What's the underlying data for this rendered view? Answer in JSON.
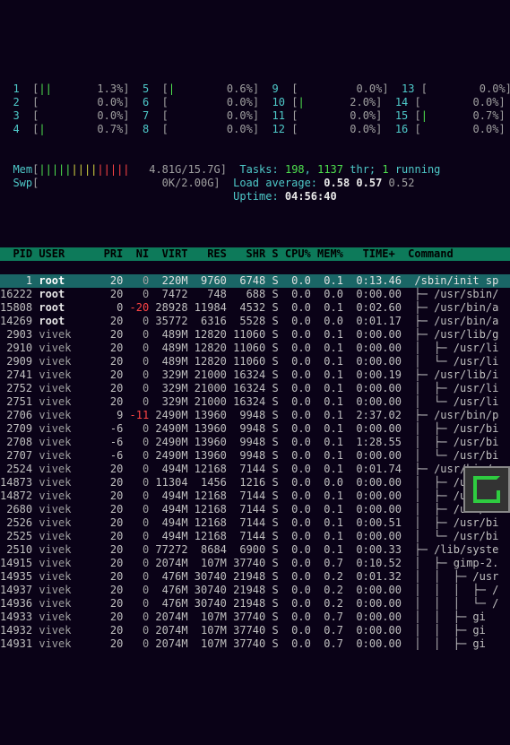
{
  "cpu_meters_left": [
    {
      "id": "1",
      "bar": "[||      ",
      "pct": "1.3%]"
    },
    {
      "id": "2",
      "bar": "[        ",
      "pct": "0.0%]"
    },
    {
      "id": "3",
      "bar": "[        ",
      "pct": "0.0%]"
    },
    {
      "id": "4",
      "bar": "[|       ",
      "pct": "0.7%]"
    }
  ],
  "cpu_meters_r2": [
    {
      "id": "5",
      "bar": "[|       ",
      "pct": "0.6%]"
    },
    {
      "id": "6",
      "bar": "[        ",
      "pct": "0.0%]"
    },
    {
      "id": "7",
      "bar": "[        ",
      "pct": "0.0%]"
    },
    {
      "id": "8",
      "bar": "[        ",
      "pct": "0.0%]"
    }
  ],
  "cpu_meters_r3": [
    {
      "id": "9",
      "bar": "[        ",
      "pct": "0.0%]"
    },
    {
      "id": "10",
      "bar": "[|      ",
      "pct": "2.0%]"
    },
    {
      "id": "11",
      "bar": "[       ",
      "pct": "0.0%]"
    },
    {
      "id": "12",
      "bar": "[       ",
      "pct": "0.0%]"
    }
  ],
  "cpu_meters_r4": [
    {
      "id": "13",
      "bar": "[       ",
      "pct": "0.0%]"
    },
    {
      "id": "14",
      "bar": "[       ",
      "pct": "0.0%]"
    },
    {
      "id": "15",
      "bar": "[|      ",
      "pct": "0.7%]"
    },
    {
      "id": "16",
      "bar": "[       ",
      "pct": "0.0%]"
    }
  ],
  "mem": {
    "label": "Mem",
    "bar": "[|||||||||||||||||  ",
    "val": "4.81G/15.7G]"
  },
  "swp": {
    "label": "Swp",
    "bar": "[                   ",
    "val": "0K/2.00G]"
  },
  "tasks": {
    "label": "Tasks:",
    "procs": "198",
    "sep": ", ",
    "threads": "1137",
    "thr": " thr; ",
    "run": "1",
    "running": " running"
  },
  "loadavg": {
    "label": "Load average:",
    "v1": "0.58",
    "v2": "0.57",
    "v3": "0.52"
  },
  "uptime": {
    "label": "Uptime:",
    "val": "04:56:40"
  },
  "header": "  PID USER      PRI  NI  VIRT   RES   SHR S CPU% MEM%   TIME+  Command",
  "rows": [
    {
      "hl": true,
      "pid": "1",
      "user": "root",
      "pri": "20",
      "ni": "0",
      "virt": "220M",
      "res": "9760",
      "shr": "6748",
      "s": "S",
      "cpu": "0.0",
      "mem": "0.1",
      "time": "0:13.46",
      "cmd": "/sbin/init sp"
    },
    {
      "pid": "16222",
      "user": "root",
      "pri": "20",
      "ni": "0",
      "virt": "7472",
      "res": "748",
      "shr": "688",
      "s": "S",
      "cpu": "0.0",
      "mem": "0.0",
      "time": "0:00.00",
      "cmd": "├─ /usr/sbin/"
    },
    {
      "pid": "15808",
      "user": "root",
      "pri": "0",
      "ni": "-20",
      "virt": "28928",
      "res": "11984",
      "shr": "4532",
      "s": "S",
      "cpu": "0.0",
      "mem": "0.1",
      "time": "0:02.60",
      "cmd": "├─ /usr/bin/a"
    },
    {
      "pid": "14269",
      "user": "root",
      "pri": "20",
      "ni": "0",
      "virt": "35772",
      "res": "6316",
      "shr": "5528",
      "s": "S",
      "cpu": "0.0",
      "mem": "0.0",
      "time": "0:01.17",
      "cmd": "├─ /usr/bin/a"
    },
    {
      "pid": "2903",
      "user": "vivek",
      "pri": "20",
      "ni": "0",
      "virt": "489M",
      "res": "12820",
      "shr": "11060",
      "s": "S",
      "cpu": "0.0",
      "mem": "0.1",
      "time": "0:00.00",
      "cmd": "├─ /usr/lib/g"
    },
    {
      "pid": "2910",
      "user": "vivek",
      "pri": "20",
      "ni": "0",
      "virt": "489M",
      "res": "12820",
      "shr": "11060",
      "s": "S",
      "cpu": "0.0",
      "mem": "0.1",
      "time": "0:00.00",
      "cmd": "│  ├─ /usr/li"
    },
    {
      "pid": "2909",
      "user": "vivek",
      "pri": "20",
      "ni": "0",
      "virt": "489M",
      "res": "12820",
      "shr": "11060",
      "s": "S",
      "cpu": "0.0",
      "mem": "0.1",
      "time": "0:00.00",
      "cmd": "│  └─ /usr/li"
    },
    {
      "pid": "2741",
      "user": "vivek",
      "pri": "20",
      "ni": "0",
      "virt": "329M",
      "res": "21000",
      "shr": "16324",
      "s": "S",
      "cpu": "0.0",
      "mem": "0.1",
      "time": "0:00.19",
      "cmd": "├─ /usr/lib/i"
    },
    {
      "pid": "2752",
      "user": "vivek",
      "pri": "20",
      "ni": "0",
      "virt": "329M",
      "res": "21000",
      "shr": "16324",
      "s": "S",
      "cpu": "0.0",
      "mem": "0.1",
      "time": "0:00.00",
      "cmd": "│  ├─ /usr/li"
    },
    {
      "pid": "2751",
      "user": "vivek",
      "pri": "20",
      "ni": "0",
      "virt": "329M",
      "res": "21000",
      "shr": "16324",
      "s": "S",
      "cpu": "0.0",
      "mem": "0.1",
      "time": "0:00.00",
      "cmd": "│  └─ /usr/li"
    },
    {
      "pid": "2706",
      "user": "vivek",
      "pri": "9",
      "ni": "-11",
      "virt": "2490M",
      "res": "13960",
      "shr": "9948",
      "s": "S",
      "cpu": "0.0",
      "mem": "0.1",
      "time": "2:37.02",
      "cmd": "├─ /usr/bin/p"
    },
    {
      "pid": "2709",
      "user": "vivek",
      "pri": "-6",
      "ni": "0",
      "virt": "2490M",
      "res": "13960",
      "shr": "9948",
      "s": "S",
      "cpu": "0.0",
      "mem": "0.1",
      "time": "0:00.00",
      "cmd": "│  ├─ /usr/bi"
    },
    {
      "pid": "2708",
      "user": "vivek",
      "pri": "-6",
      "ni": "0",
      "virt": "2490M",
      "res": "13960",
      "shr": "9948",
      "s": "S",
      "cpu": "0.0",
      "mem": "0.1",
      "time": "1:28.55",
      "cmd": "│  ├─ /usr/bi"
    },
    {
      "pid": "2707",
      "user": "vivek",
      "pri": "-6",
      "ni": "0",
      "virt": "2490M",
      "res": "13960",
      "shr": "9948",
      "s": "S",
      "cpu": "0.0",
      "mem": "0.1",
      "time": "0:00.00",
      "cmd": "│  └─ /usr/bi"
    },
    {
      "pid": "2524",
      "user": "vivek",
      "pri": "20",
      "ni": "0",
      "virt": "494M",
      "res": "12168",
      "shr": "7144",
      "s": "S",
      "cpu": "0.0",
      "mem": "0.1",
      "time": "0:01.74",
      "cmd": "├─ /usr/bin/g"
    },
    {
      "pid": "14873",
      "user": "vivek",
      "pri": "20",
      "ni": "0",
      "virt": "11304",
      "res": "1456",
      "shr": "1216",
      "s": "S",
      "cpu": "0.0",
      "mem": "0.0",
      "time": "0:00.00",
      "cmd": "│  ├─ /usr/bi"
    },
    {
      "pid": "14872",
      "user": "vivek",
      "pri": "20",
      "ni": "0",
      "virt": "494M",
      "res": "12168",
      "shr": "7144",
      "s": "S",
      "cpu": "0.0",
      "mem": "0.1",
      "time": "0:00.00",
      "cmd": "│  ├─ /usr/bi"
    },
    {
      "pid": "2680",
      "user": "vivek",
      "pri": "20",
      "ni": "0",
      "virt": "494M",
      "res": "12168",
      "shr": "7144",
      "s": "S",
      "cpu": "0.0",
      "mem": "0.1",
      "time": "0:00.00",
      "cmd": "│  ├─ /usr/bi"
    },
    {
      "pid": "2526",
      "user": "vivek",
      "pri": "20",
      "ni": "0",
      "virt": "494M",
      "res": "12168",
      "shr": "7144",
      "s": "S",
      "cpu": "0.0",
      "mem": "0.1",
      "time": "0:00.51",
      "cmd": "│  ├─ /usr/bi"
    },
    {
      "pid": "2525",
      "user": "vivek",
      "pri": "20",
      "ni": "0",
      "virt": "494M",
      "res": "12168",
      "shr": "7144",
      "s": "S",
      "cpu": "0.0",
      "mem": "0.1",
      "time": "0:00.00",
      "cmd": "│  └─ /usr/bi"
    },
    {
      "pid": "2510",
      "user": "vivek",
      "pri": "20",
      "ni": "0",
      "virt": "77272",
      "res": "8684",
      "shr": "6900",
      "s": "S",
      "cpu": "0.0",
      "mem": "0.1",
      "time": "0:00.33",
      "cmd": "├─ /lib/syste"
    },
    {
      "pid": "14915",
      "user": "vivek",
      "pri": "20",
      "ni": "0",
      "virt": "2074M",
      "res": "107M",
      "shr": "37740",
      "s": "S",
      "cpu": "0.0",
      "mem": "0.7",
      "time": "0:10.52",
      "cmd": "│  ├─ gimp-2."
    },
    {
      "pid": "14935",
      "user": "vivek",
      "pri": "20",
      "ni": "0",
      "virt": "476M",
      "res": "30740",
      "shr": "21948",
      "s": "S",
      "cpu": "0.0",
      "mem": "0.2",
      "time": "0:01.32",
      "cmd": "│  │  ├─ /usr"
    },
    {
      "pid": "14937",
      "user": "vivek",
      "pri": "20",
      "ni": "0",
      "virt": "476M",
      "res": "30740",
      "shr": "21948",
      "s": "S",
      "cpu": "0.0",
      "mem": "0.2",
      "time": "0:00.00",
      "cmd": "│  │  │  ├─ /"
    },
    {
      "pid": "14936",
      "user": "vivek",
      "pri": "20",
      "ni": "0",
      "virt": "476M",
      "res": "30740",
      "shr": "21948",
      "s": "S",
      "cpu": "0.0",
      "mem": "0.2",
      "time": "0:00.00",
      "cmd": "│  │  │  └─ /"
    },
    {
      "pid": "14933",
      "user": "vivek",
      "pri": "20",
      "ni": "0",
      "virt": "2074M",
      "res": "107M",
      "shr": "37740",
      "s": "S",
      "cpu": "0.0",
      "mem": "0.7",
      "time": "0:00.00",
      "cmd": "│  │  ├─ gi"
    },
    {
      "pid": "14932",
      "user": "vivek",
      "pri": "20",
      "ni": "0",
      "virt": "2074M",
      "res": "107M",
      "shr": "37740",
      "s": "S",
      "cpu": "0.0",
      "mem": "0.7",
      "time": "0:00.00",
      "cmd": "│  │  ├─ gi"
    },
    {
      "pid": "14931",
      "user": "vivek",
      "pri": "20",
      "ni": "0",
      "virt": "2074M",
      "res": "107M",
      "shr": "37740",
      "s": "S",
      "cpu": "0.0",
      "mem": "0.7",
      "time": "0:00.00",
      "cmd": "│  │  ├─ gi"
    }
  ]
}
